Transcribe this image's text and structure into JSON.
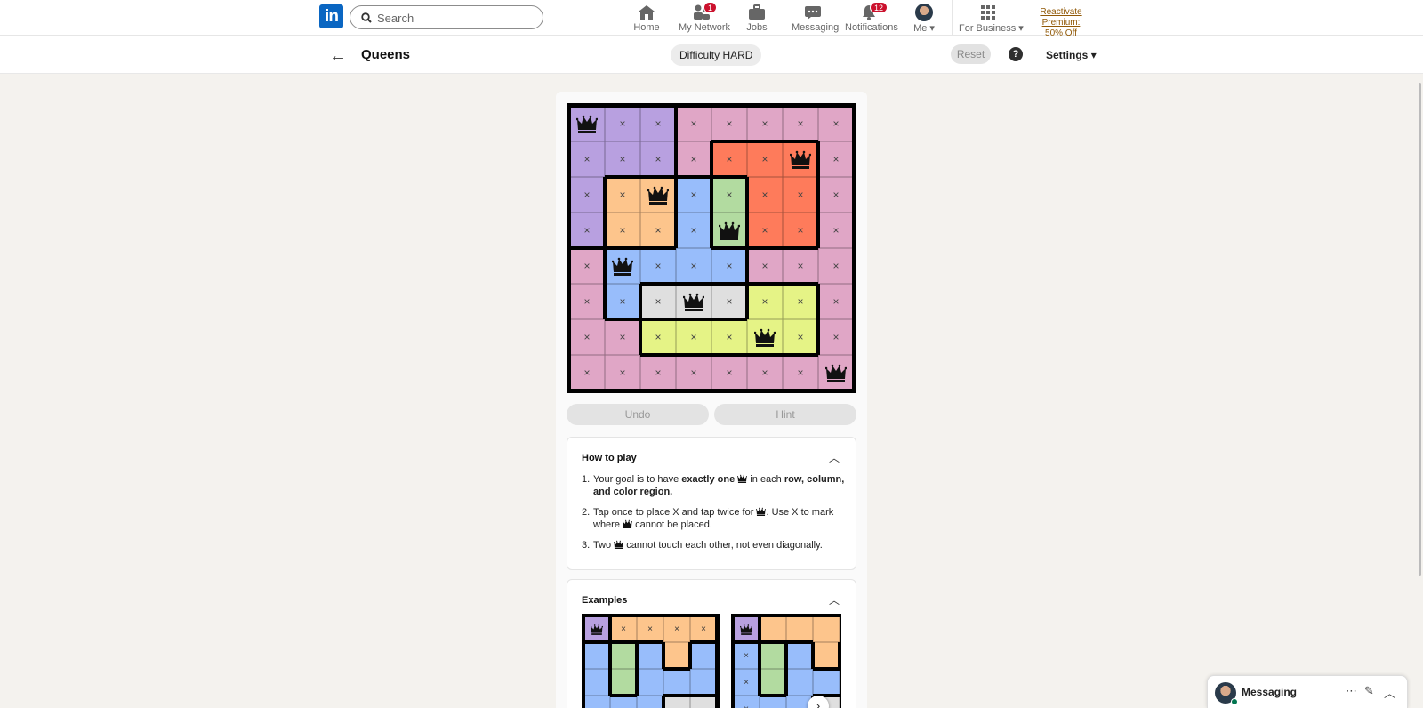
{
  "nav": {
    "logo": "in",
    "search_placeholder": "Search",
    "items": [
      {
        "label": "Home",
        "icon": "home-icon",
        "badge": ""
      },
      {
        "label": "My Network",
        "icon": "network-icon",
        "badge": "1"
      },
      {
        "label": "Jobs",
        "icon": "briefcase-icon",
        "badge": ""
      },
      {
        "label": "Messaging",
        "icon": "chat-icon",
        "badge": ""
      },
      {
        "label": "Notifications",
        "icon": "bell-icon",
        "badge": "12"
      },
      {
        "label": "Me",
        "icon": "avatar",
        "badge": ""
      },
      {
        "label": "For Business",
        "icon": "grid-icon",
        "badge": ""
      }
    ],
    "premium_line1": "Reactivate Premium:",
    "premium_line2": "50% Off"
  },
  "subheader": {
    "title": "Queens",
    "difficulty": "Difficulty HARD",
    "reset": "Reset",
    "help": "?",
    "settings": "Settings"
  },
  "board": {
    "size": 8,
    "colors": {
      "P": "#b8a0e0",
      "K": "#e0a6c6",
      "R": "#fe7b5b",
      "O": "#fdc58c",
      "B": "#98bdfb",
      "G": "#b2dba0",
      "W": "#dfdfdf",
      "Y": "#e5f386"
    },
    "regions": [
      "PPPKKKKK",
      "PPPKRRRK",
      "POOBGRRK",
      "POOBGRRK",
      "KBBBBKKK",
      "KBWWWYYK",
      "KKYYYYYK",
      "KKKKKKKK"
    ],
    "marks": [
      "QXXXXXXX",
      "XXXXXXQX",
      "XXQXXXXX",
      "XXXXQXXX",
      "XQXXXXXX",
      "XXXQXXXX",
      "XXXXXQXX",
      "XXXXXXXQ"
    ]
  },
  "buttons": {
    "undo": "Undo",
    "hint": "Hint"
  },
  "how_to_play": {
    "title": "How to play",
    "r1_a": "Your goal is to have ",
    "r1_b": "exactly one",
    "r1_c": " in each ",
    "r1_d": "row, column, and color region.",
    "r2_a": "Tap once to place X and tap twice for ",
    "r2_b": ". Use X to mark where ",
    "r2_c": " cannot be placed.",
    "r3_a": "Two ",
    "r3_b": " cannot touch each other, not even diagonally."
  },
  "examples": {
    "title": "Examples",
    "ex1": {
      "regions": [
        "POOOO",
        "BGBOB",
        "BGBBB",
        "BBBWW"
      ],
      "marks": [
        "QXXXX",
        "-----",
        "-----",
        "-----"
      ]
    },
    "ex2": {
      "regions": [
        "POOOO",
        "BGBOB",
        "BGBBB",
        "BBBWW"
      ],
      "marks": [
        "Q----",
        "X----",
        "X----",
        "X----"
      ]
    },
    "next": "›"
  },
  "messaging": {
    "label": "Messaging"
  }
}
